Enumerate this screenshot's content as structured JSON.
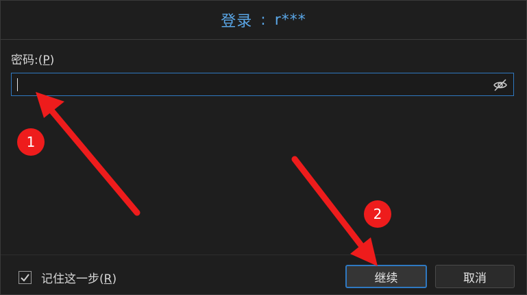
{
  "title": {
    "label": "登录",
    "separator": ":",
    "user": "r***"
  },
  "password": {
    "label_text": "密码:(",
    "label_key": "P",
    "label_end": ")",
    "value": ""
  },
  "remember": {
    "label_text": "记住这一步(",
    "label_key": "R",
    "label_end": ")",
    "checked": true
  },
  "buttons": {
    "continue": "继续",
    "cancel": "取消"
  },
  "annotations": {
    "badge1": "1",
    "badge2": "2"
  },
  "colors": {
    "accent": "#2f79c2",
    "title": "#5aa6e6",
    "annotation": "#ee1c1c"
  }
}
